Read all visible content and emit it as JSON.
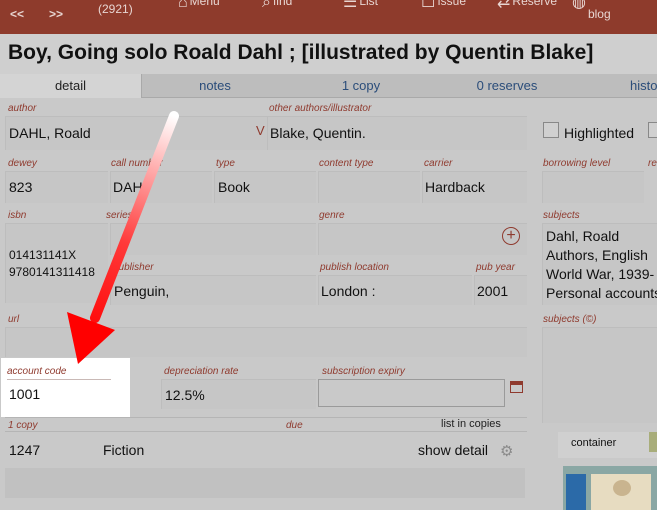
{
  "toolbar": {
    "prev": "<<",
    "next": ">>",
    "count": "(2921)",
    "items": [
      {
        "label": "Menu",
        "icon": "home-icon"
      },
      {
        "label": "find",
        "icon": "search-icon"
      },
      {
        "label": "List",
        "icon": "list-icon"
      },
      {
        "label": "Issue",
        "icon": "issue-icon"
      },
      {
        "label": "Reserve",
        "icon": "reserve-icon"
      },
      {
        "label": "blog",
        "icon": "globe-icon"
      }
    ]
  },
  "title": "Boy, Going solo Roald Dahl ; [illustrated by Quentin Blake]",
  "tabs": [
    "detail",
    "notes",
    "1 copy",
    "0 reserves",
    "histo"
  ],
  "fields": {
    "author": {
      "label": "author",
      "value": "DAHL, Roald",
      "flag": "V"
    },
    "other_authors": {
      "label": "other authors/illustrator",
      "value": "Blake, Quentin."
    },
    "highlighted": {
      "label": "Highlighted"
    },
    "dewey": {
      "label": "dewey",
      "value": "823"
    },
    "call_number": {
      "label": "call number",
      "value": "DAH"
    },
    "type": {
      "label": "type",
      "value": "Book"
    },
    "content_type": {
      "label": "content type",
      "value": ""
    },
    "carrier": {
      "label": "carrier",
      "value": "Hardback"
    },
    "borrowing_level": {
      "label": "borrowing level",
      "value": ""
    },
    "re": {
      "label": "re"
    },
    "isbn": {
      "label": "isbn",
      "values": [
        "014131141X",
        "9780141311418"
      ]
    },
    "series": {
      "label": "series"
    },
    "genre": {
      "label": "genre",
      "value": ""
    },
    "subjects": {
      "label": "subjects",
      "values": [
        "Dahl, Roald",
        "Authors, English",
        "World War, 1939-",
        "Personal accounts"
      ]
    },
    "publisher": {
      "label": "publisher",
      "value": "Penguin,"
    },
    "publish_location": {
      "label": "publish location",
      "value": "London :"
    },
    "pub_year": {
      "label": "pub year",
      "value": "2001"
    },
    "url": {
      "label": "url",
      "value": ""
    },
    "subjects_c": {
      "label": "subjects (©)"
    },
    "account_code": {
      "label": "account code",
      "value": "1001"
    },
    "depreciation_rate": {
      "label": "depreciation rate",
      "value": "12.5%"
    },
    "subscription_expiry": {
      "label": "subscription expiry",
      "value": ""
    }
  },
  "copies": {
    "header": "1 copy",
    "due_label": "due",
    "list_label": "list in copies",
    "rows": [
      {
        "barcode": "1247",
        "location": "Fiction",
        "action": "show detail"
      }
    ]
  },
  "container": {
    "label": "container"
  },
  "colors": {
    "toolbar": "#8e3b2c",
    "label": "#8f3a2e",
    "arrow": "#ff0000",
    "tab_link": "#2b4d7a"
  }
}
